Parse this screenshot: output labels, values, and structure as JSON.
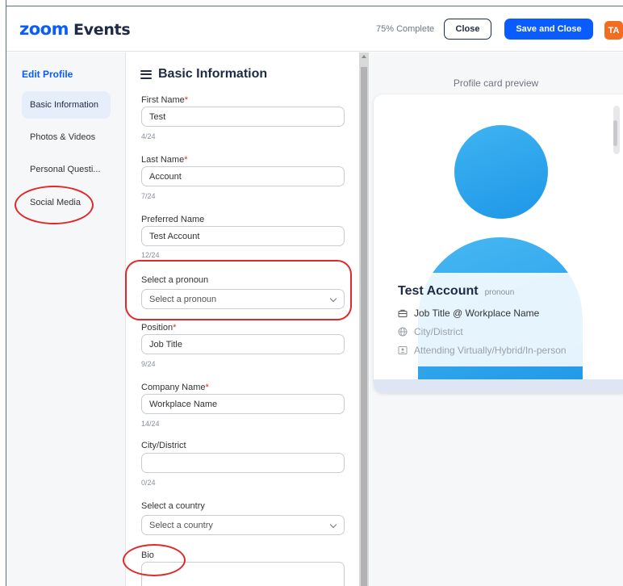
{
  "header": {
    "logo_zoom": "zoom",
    "logo_events": "Events",
    "progress": "75% Complete",
    "close_label": "Close",
    "save_label": "Save and Close",
    "avatar_initials": "TA"
  },
  "nav": {
    "title": "Edit Profile",
    "items": [
      {
        "label": "Basic Information",
        "active": true
      },
      {
        "label": "Photos & Videos",
        "active": false
      },
      {
        "label": "Personal Questi...",
        "active": false
      },
      {
        "label": "Social Media",
        "active": false
      }
    ]
  },
  "form": {
    "title": "Basic Information",
    "fields": {
      "first_name": {
        "label": "First Name",
        "required": "*",
        "value": "Test",
        "counter": "4/24"
      },
      "last_name": {
        "label": "Last Name",
        "required": "*",
        "value": "Account",
        "counter": "7/24"
      },
      "preferred_name": {
        "label": "Preferred Name",
        "value": "Test Account",
        "counter": "12/24"
      },
      "pronoun": {
        "label": "Select a pronoun",
        "placeholder": "Select a pronoun"
      },
      "position": {
        "label": "Position",
        "required": "*",
        "value": "Job Title",
        "counter": "9/24"
      },
      "company": {
        "label": "Company Name",
        "required": "*",
        "value": "Workplace Name",
        "counter": "14/24"
      },
      "city": {
        "label": "City/District",
        "value": "",
        "counter": "0/24"
      },
      "country": {
        "label": "Select a country",
        "placeholder": "Select a country"
      },
      "bio": {
        "label": "Bio"
      }
    }
  },
  "preview": {
    "title": "Profile card preview",
    "name": "Test Account",
    "pronoun": "pronoun",
    "job_line": "Job Title @ Workplace Name",
    "city_line": "City/District",
    "attendance_line": "Attending Virtually/Hybrid/In-person"
  },
  "colors": {
    "brand": "#0b5cff",
    "avatar": "#f26d21",
    "annotation": "#e02828",
    "silhouette": "#1e96e6"
  },
  "icons": [
    "menu-icon",
    "chevron-down-icon",
    "briefcase-icon",
    "globe-icon",
    "id-badge-icon"
  ]
}
